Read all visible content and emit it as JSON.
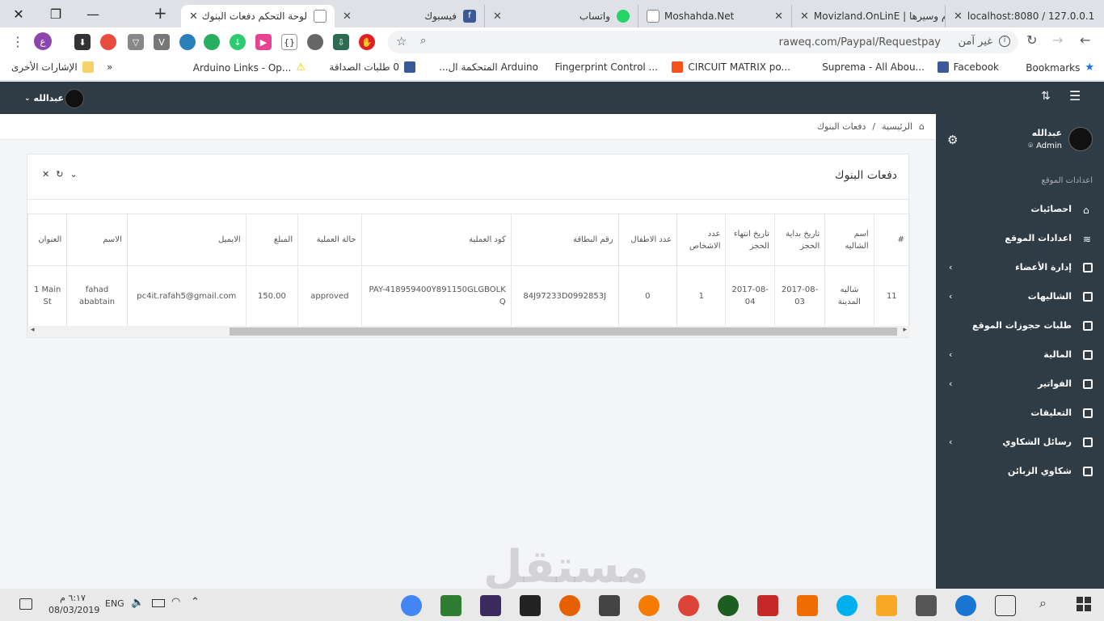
{
  "browser": {
    "tabs": [
      {
        "title": "لوحة التحكم دفعات البنوك",
        "active": true
      },
      {
        "title": "فيسبوك"
      },
      {
        "title": "واتساب"
      },
      {
        "title": "Moshahda.Net"
      },
      {
        "title": "Movizland.OnLinE | أفلام وسيرها"
      },
      {
        "title": "localhost:8080 / 127.0.0.1"
      }
    ],
    "url": "raweq.com/Paypal/Requestpay",
    "security_label": "غير آمن",
    "bookmarks": [
      {
        "label": "Bookmarks"
      },
      {
        "label": "Facebook"
      },
      {
        "label": "Suprema - All Abou..."
      },
      {
        "label": "CIRCUIT MATRIX po..."
      },
      {
        "label": "Fingerprint Control ..."
      },
      {
        "label": "Arduino المتحكمة ال..."
      },
      {
        "label": "0 طلبات الصداقة"
      },
      {
        "label": "Arduino Links - Op..."
      },
      {
        "label": "»"
      },
      {
        "label": "الإشارات الأخرى"
      }
    ],
    "profile_initial": "ع"
  },
  "app": {
    "user_name": "عبدالله",
    "breadcrumb": {
      "home": "الرئيسية",
      "separator": "/",
      "current": "دفعات البنوك"
    },
    "card_title": "دفعات البنوك",
    "sidebar": {
      "user_name": "عبدالله",
      "role": "Admin",
      "section_title": "اعدادات الموقع",
      "items": [
        {
          "label": "احصائيات"
        },
        {
          "label": "اعدادات الموقع"
        },
        {
          "label": "إدارة الأعضاء",
          "has_children": true
        },
        {
          "label": "الشاليهات",
          "has_children": true
        },
        {
          "label": "طلبات حجوزات الموقع"
        },
        {
          "label": "المالية",
          "has_children": true
        },
        {
          "label": "الفواتير",
          "has_children": true
        },
        {
          "label": "التعليقات"
        },
        {
          "label": "رسائل الشكاوي",
          "has_children": true
        },
        {
          "label": "شكاوي الزبائن"
        }
      ]
    },
    "table": {
      "headers": [
        "#",
        "اسم الشاليه",
        "تاريخ بداية الحجز",
        "تاريخ انتهاء الحجز",
        "عدد الاشخاص",
        "عدد الاطفال",
        "رقم البطاقة",
        "كود العملية",
        "حالة العملية",
        "المبلغ",
        "الايميل",
        "الاسم",
        "العنوان"
      ],
      "rows": [
        [
          "11",
          "شاليه المدينة",
          "2017-08-03",
          "2017-08-04",
          "1",
          "0",
          "84J97233D0992853J",
          "PAY-418959400Y891150GLGBOLKQ",
          "approved",
          "150.00",
          "pc4it.rafah5@gmail.com",
          "fahad ababtain",
          "1 Main St"
        ]
      ]
    }
  },
  "taskbar": {
    "time": "٦:١٧ م",
    "date": "08/03/2019",
    "language": "ENG"
  },
  "watermark": "مستقل"
}
